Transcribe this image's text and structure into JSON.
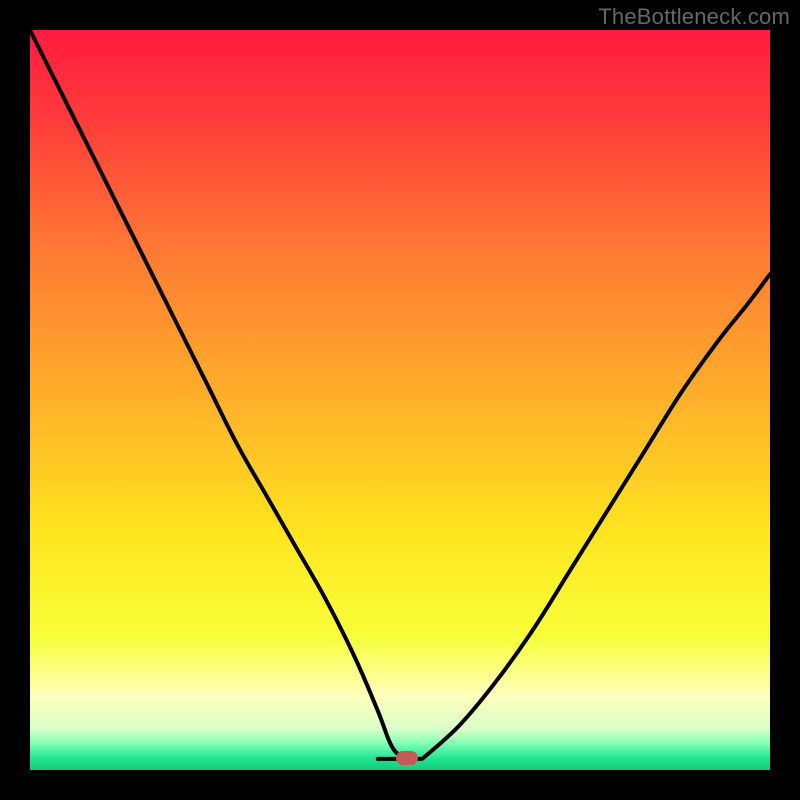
{
  "credit": "TheBottleneck.com",
  "marker": {
    "x_pct": 51,
    "y_pct": 98.4,
    "color": "#c65a56"
  },
  "gradient_stops": [
    {
      "offset": 0,
      "color": "#ff1b3f"
    },
    {
      "offset": 0.12,
      "color": "#ff3b3b"
    },
    {
      "offset": 0.3,
      "color": "#ff7a33"
    },
    {
      "offset": 0.5,
      "color": "#ffb02a"
    },
    {
      "offset": 0.68,
      "color": "#ffe51f"
    },
    {
      "offset": 0.82,
      "color": "#f7ff3a"
    },
    {
      "offset": 0.9,
      "color": "#ffffbc"
    },
    {
      "offset": 0.945,
      "color": "#d8ffc8"
    },
    {
      "offset": 0.965,
      "color": "#7dffb2"
    },
    {
      "offset": 0.985,
      "color": "#1ee38f"
    },
    {
      "offset": 1.0,
      "color": "#17c97b"
    }
  ],
  "chart_data": {
    "type": "line",
    "title": "",
    "xlabel": "",
    "ylabel": "",
    "ylim": [
      0,
      100
    ],
    "xlim": [
      0,
      100
    ],
    "series": [
      {
        "name": "left-curve",
        "x": [
          0,
          4,
          8,
          12,
          16,
          20,
          24,
          28,
          32,
          36,
          40,
          44,
          47,
          49,
          51
        ],
        "values": [
          100,
          92,
          84,
          76,
          68,
          60,
          52,
          44,
          37,
          30,
          23,
          15,
          8,
          3,
          1.5
        ]
      },
      {
        "name": "valley-flat",
        "x": [
          47,
          53
        ],
        "values": [
          1.5,
          1.5
        ]
      },
      {
        "name": "right-curve",
        "x": [
          53,
          58,
          63,
          68,
          73,
          78,
          83,
          88,
          93,
          97,
          100
        ],
        "values": [
          1.5,
          6,
          12,
          19,
          27,
          35,
          43,
          51,
          58,
          63,
          67
        ]
      }
    ],
    "optimum_marker": {
      "x": 51,
      "y": 1.6
    }
  }
}
